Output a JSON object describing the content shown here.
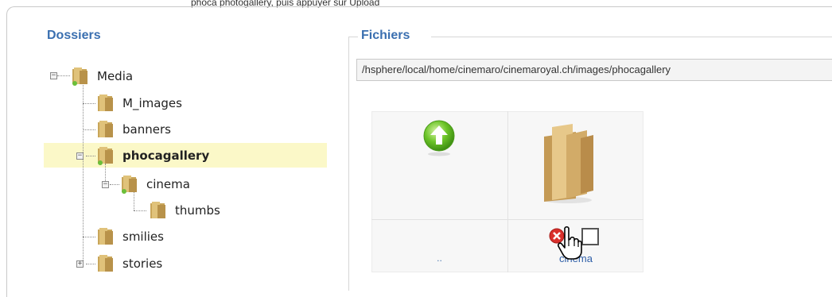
{
  "top_cut_text": "phoca  photogallery, puis appuyer sur Upload",
  "dossiers": {
    "title": "Dossiers",
    "tree": [
      {
        "label": "Media",
        "level": 0,
        "toggle": "minus",
        "selected": false
      },
      {
        "label": "M_images",
        "level": 1,
        "toggle": "none",
        "selected": false
      },
      {
        "label": "banners",
        "level": 1,
        "toggle": "none",
        "selected": false
      },
      {
        "label": "phocagallery",
        "level": 1,
        "toggle": "minus",
        "selected": true
      },
      {
        "label": "cinema",
        "level": 2,
        "toggle": "minus",
        "selected": false
      },
      {
        "label": "thumbs",
        "level": 3,
        "toggle": "none",
        "selected": false
      },
      {
        "label": "smilies",
        "level": 1,
        "toggle": "none",
        "selected": false
      },
      {
        "label": "stories",
        "level": 1,
        "toggle": "plus",
        "selected": false
      }
    ]
  },
  "fichiers": {
    "title": "Fichiers",
    "path": "/hsphere/local/home/cinemaro/cinemaroyal.ch/images/phocagallery",
    "items": [
      {
        "label": "..",
        "icon": "up-arrow-icon"
      },
      {
        "label": "cinema",
        "icon": "folder-icon"
      }
    ]
  },
  "colors": {
    "title": "#3a6fb0",
    "selected_row": "#fbf8c8",
    "link": "#2f5fa8"
  }
}
